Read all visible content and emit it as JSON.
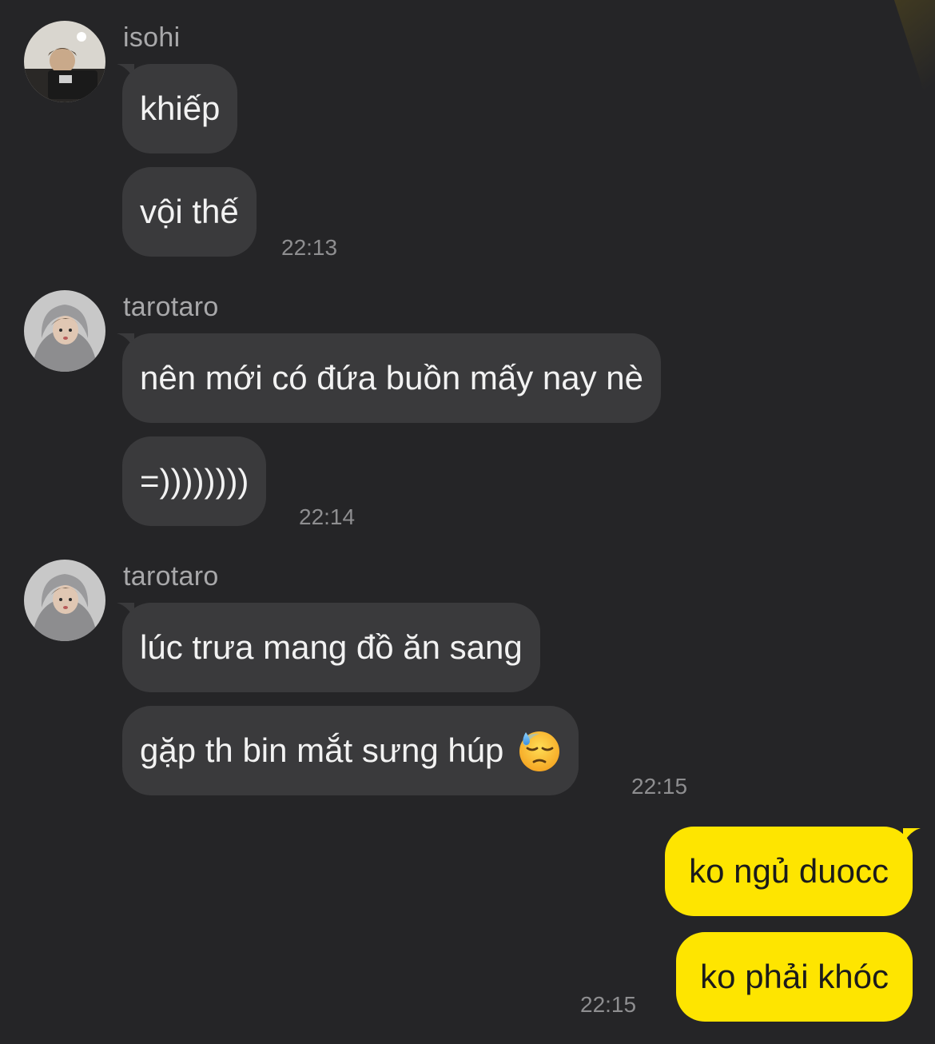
{
  "messages": [
    {
      "sender": "isohi",
      "lines": [
        "khiếp",
        "vội thế"
      ],
      "time": "22:13"
    },
    {
      "sender": "tarotaro",
      "lines": [
        "nên mới có đứa buồn mấy nay nè",
        "=))))))))"
      ],
      "time": "22:14"
    },
    {
      "sender": "tarotaro",
      "lines": [
        "lúc trưa mang đồ ăn sang",
        "gặp th bin mắt sưng húp"
      ],
      "emoji": "downcast-sweat-face-emoji",
      "time": "22:15"
    }
  ],
  "outgoing": {
    "lines": [
      "ko ngủ duocc",
      "ko phải khóc"
    ],
    "time": "22:15"
  },
  "colors": {
    "background": "#252527",
    "incoming_bubble": "#3a3a3c",
    "outgoing_bubble": "#fee500",
    "timestamp": "#8e8e90",
    "sender_name": "#a8a8aa"
  }
}
